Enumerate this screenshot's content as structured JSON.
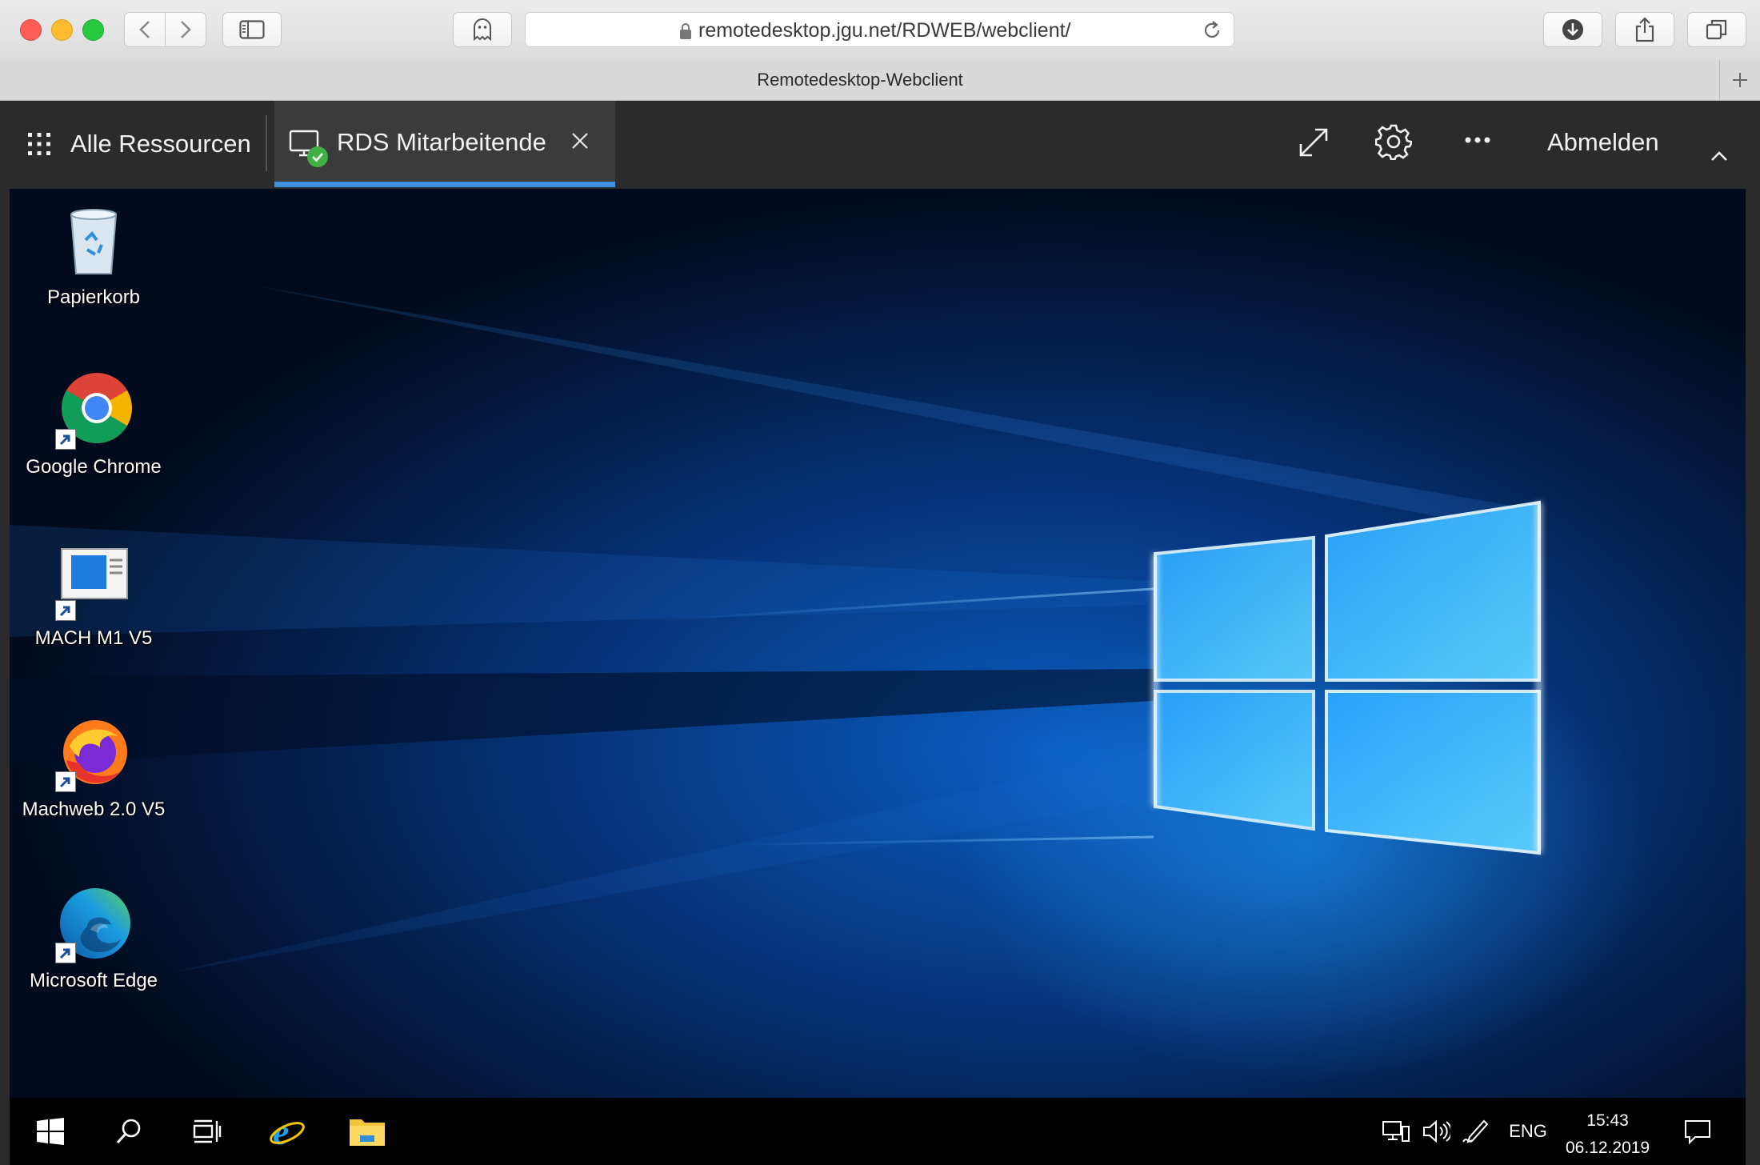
{
  "browser": {
    "url": "remotedesktop.jgu.net/RDWEB/webclient/",
    "tab_title": "Remotedesktop-Webclient"
  },
  "rdclient": {
    "all_resources_label": "Alle Ressourcen",
    "session_tab_label": "RDS Mitarbeitende",
    "logout_label": "Abmelden"
  },
  "desktop": {
    "icons": [
      {
        "label": "Papierkorb",
        "icon": "recycle-bin-icon"
      },
      {
        "label": "Google Chrome",
        "icon": "chrome-icon"
      },
      {
        "label": "MACH M1 V5",
        "icon": "mach-app-icon"
      },
      {
        "label": "Machweb 2.0 V5",
        "icon": "firefox-icon"
      },
      {
        "label": "Microsoft Edge",
        "icon": "edge-icon"
      }
    ]
  },
  "taskbar": {
    "language": "ENG",
    "time": "15:43",
    "date": "06.12.2019"
  },
  "colors": {
    "accent": "#3d8fe0",
    "rdbar_bg": "#2b2b2b",
    "desktop_blue": "#0a5cc0"
  }
}
